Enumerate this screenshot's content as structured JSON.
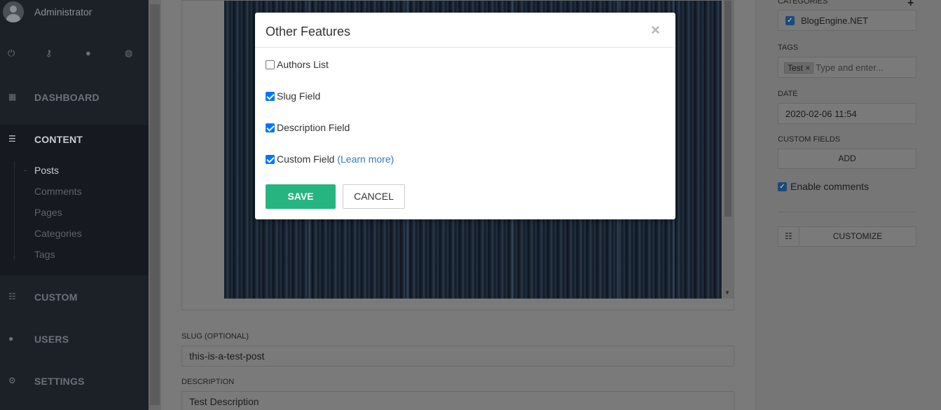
{
  "sidebar": {
    "user_name": "Administrator",
    "nav": {
      "dashboard": "DASHBOARD",
      "content": "CONTENT",
      "custom": "CUSTOM",
      "users": "USERS",
      "settings": "SETTINGS"
    },
    "content_items": [
      "Posts",
      "Comments",
      "Pages",
      "Categories",
      "Tags"
    ]
  },
  "main": {
    "slug_label": "SLUG (OPTIONAL)",
    "slug_value": "this-is-a-test-post",
    "description_label": "DESCRIPTION",
    "description_value": "Test Description"
  },
  "right_panel": {
    "categories_label": "CATEGORIES",
    "category": "BlogEngine.NET",
    "tags_label": "TAGS",
    "tag": "Test",
    "tag_remove": "×",
    "tags_placeholder": "Type and enter...",
    "date_label": "DATE",
    "date_value": "2020-02-06 11:54",
    "custom_fields_label": "CUSTOM FIELDS",
    "add_label": "ADD",
    "enable_comments": "Enable comments",
    "customize_label": "CUSTOMIZE"
  },
  "modal": {
    "title": "Other Features",
    "close": "×",
    "options": [
      {
        "label": "Authors List",
        "checked": false
      },
      {
        "label": "Slug Field",
        "checked": true
      },
      {
        "label": "Description Field",
        "checked": true
      },
      {
        "label": "Custom Field",
        "checked": true
      }
    ],
    "learn_more": "(Learn more)",
    "save_label": "SAVE",
    "cancel_label": "CANCEL"
  },
  "colors": {
    "save_button": "#26b581",
    "link": "#337ab7",
    "sidebar_bg": "#1c2128",
    "checkbox_checked": "#0075ff"
  }
}
